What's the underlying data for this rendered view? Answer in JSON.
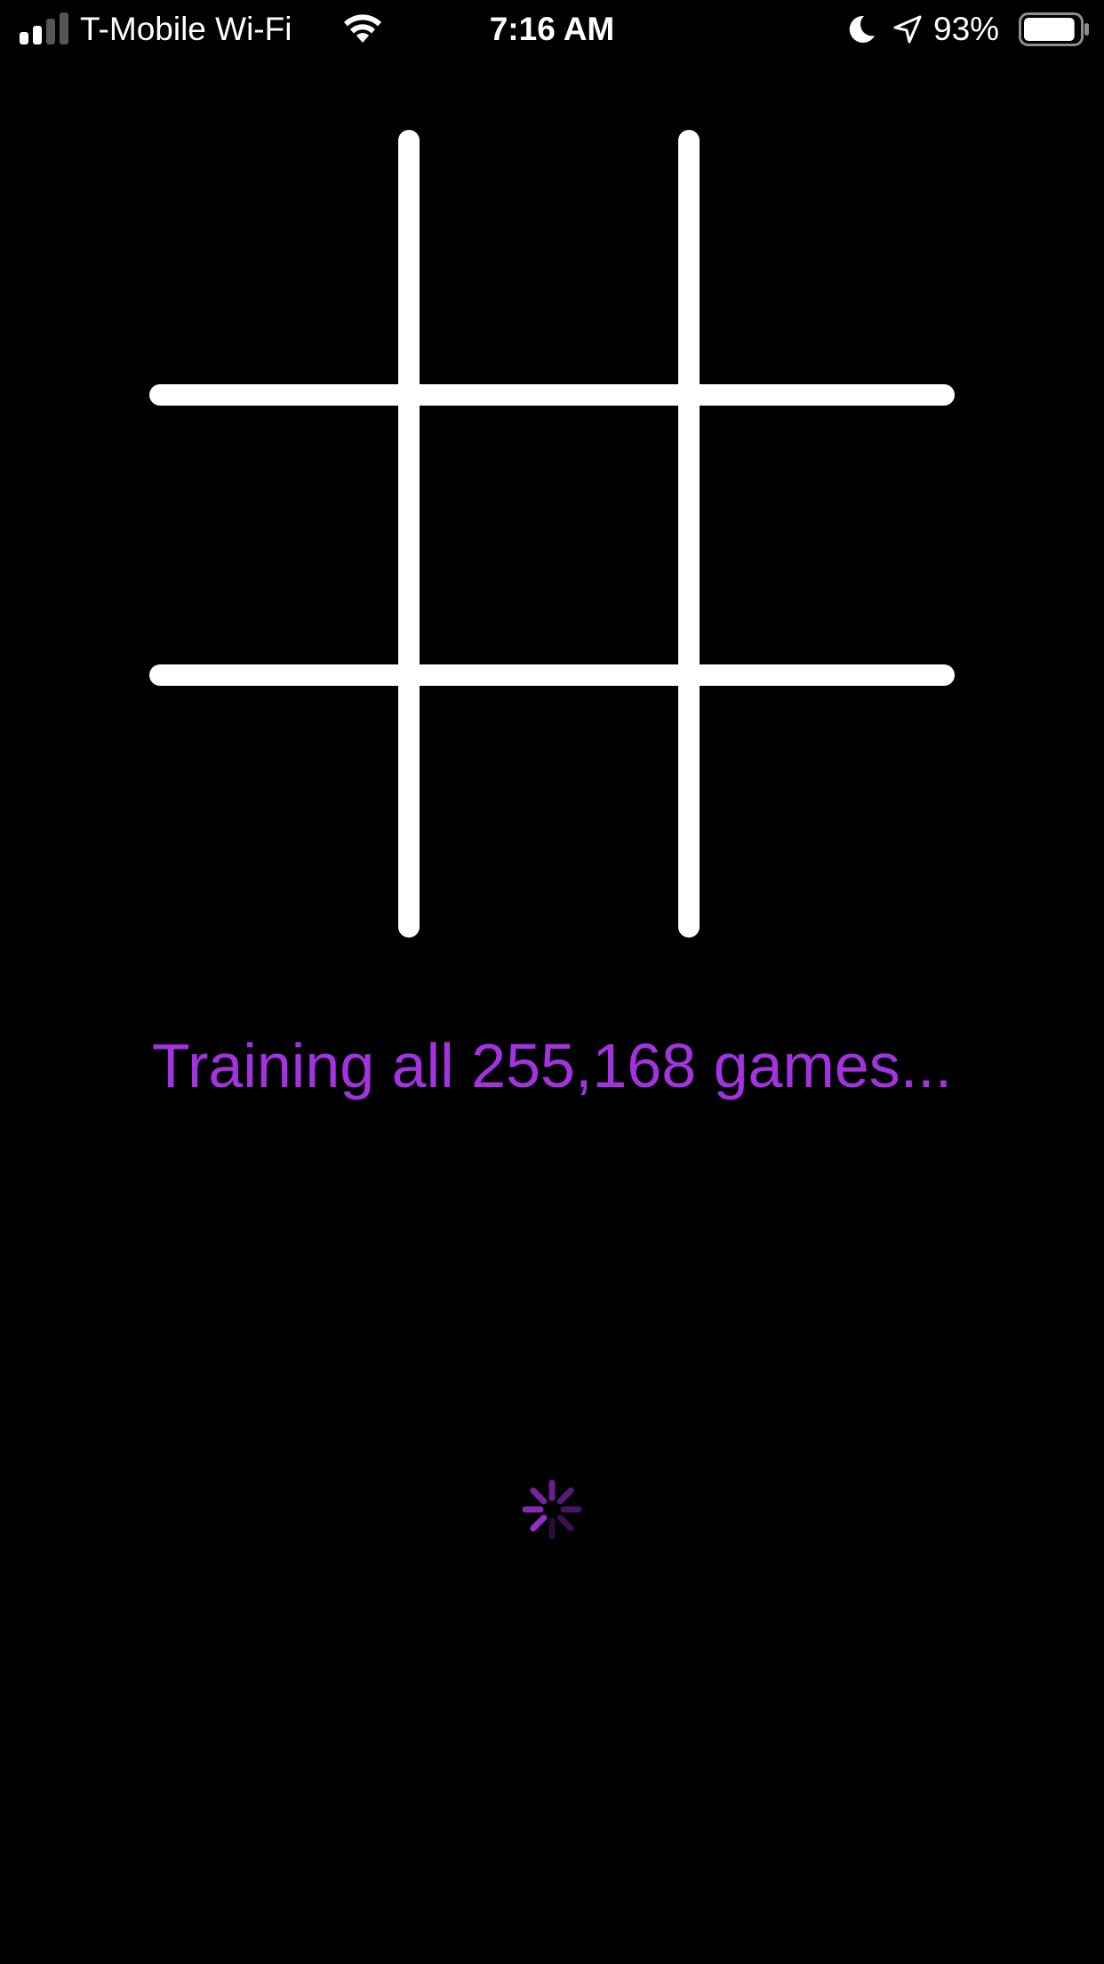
{
  "status_bar": {
    "carrier": "T-Mobile Wi-Fi",
    "time": "7:16 AM",
    "battery_percent": "93%",
    "battery_level": 0.93,
    "signal_bars_filled": 2,
    "signal_bars_total": 4,
    "icons": [
      "signal-icon",
      "wifi-icon",
      "moon-icon",
      "location-arrow-icon",
      "battery-icon"
    ]
  },
  "board": {
    "cells": [
      "",
      "",
      "",
      "",
      "",
      "",
      "",
      "",
      ""
    ],
    "line_color": "#ffffff"
  },
  "message": {
    "text": "Training all 255,168 games...",
    "color": "#a333e0"
  },
  "spinner": {
    "icon": "activity-spinner-icon",
    "color": "#a333e0"
  },
  "colors": {
    "background": "#000000",
    "accent": "#a333e0"
  }
}
